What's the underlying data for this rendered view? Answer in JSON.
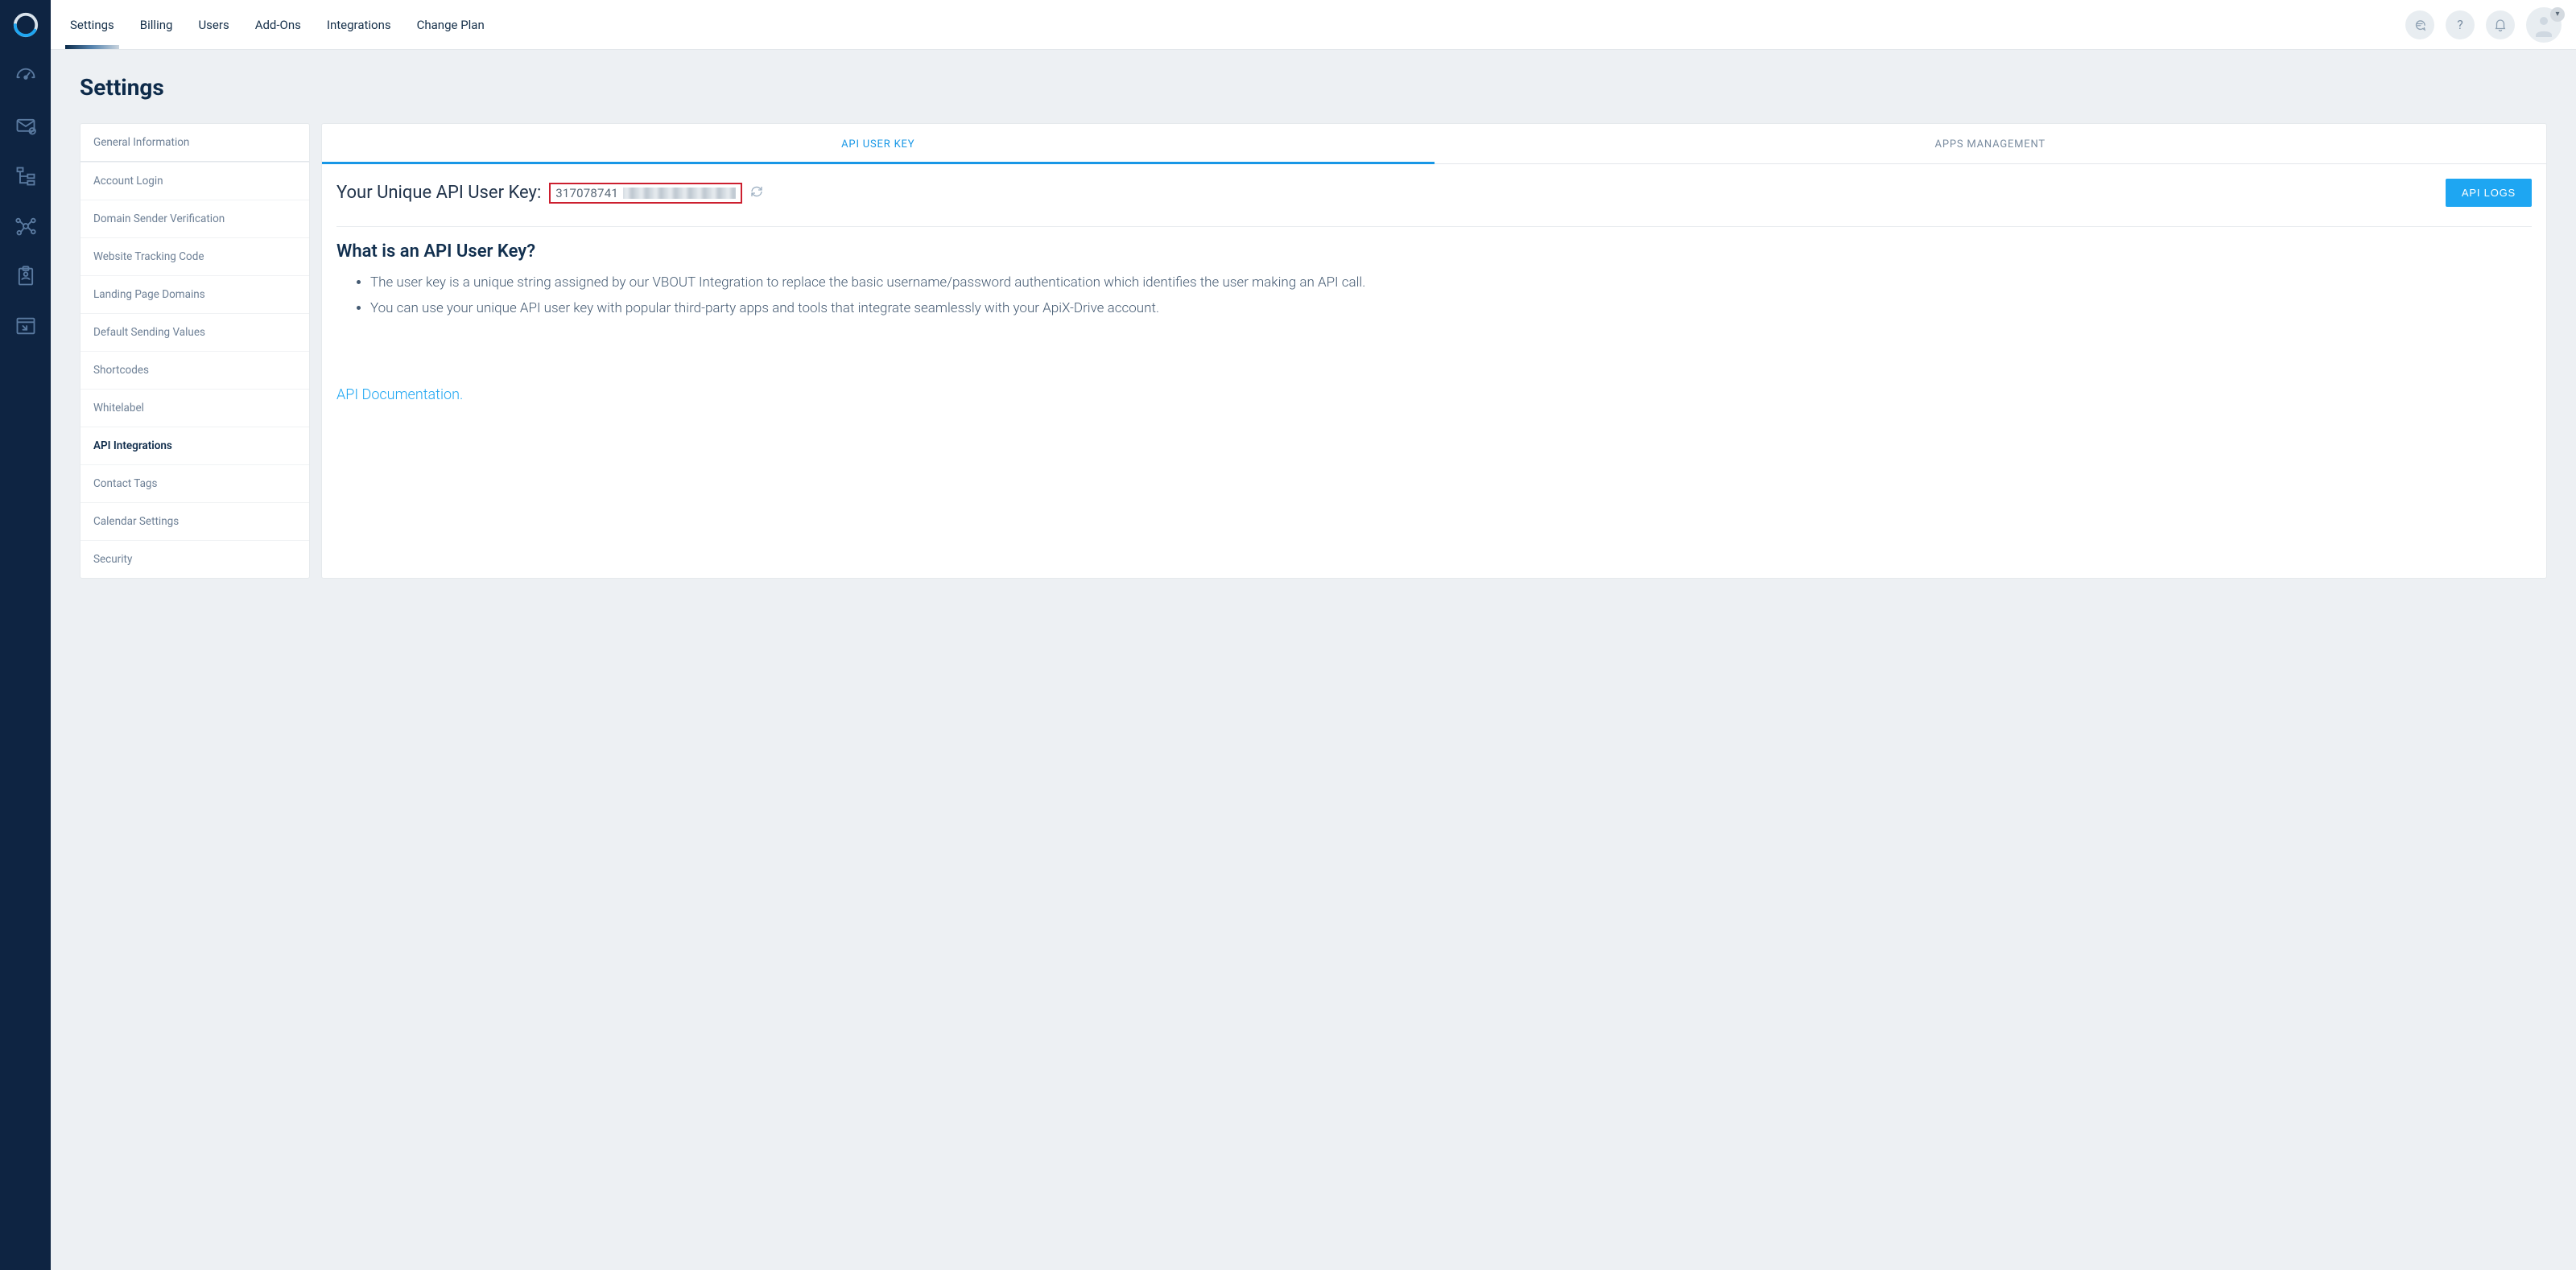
{
  "topnav": {
    "items": [
      {
        "label": "Settings",
        "active": true
      },
      {
        "label": "Billing"
      },
      {
        "label": "Users"
      },
      {
        "label": "Add-Ons"
      },
      {
        "label": "Integrations"
      },
      {
        "label": "Change Plan"
      }
    ]
  },
  "page": {
    "title": "Settings"
  },
  "sidebar": {
    "items": [
      {
        "label": "General Information"
      },
      {
        "label": "Account Login"
      },
      {
        "label": "Domain Sender Verification"
      },
      {
        "label": "Website Tracking Code"
      },
      {
        "label": "Landing Page Domains"
      },
      {
        "label": "Default Sending Values"
      },
      {
        "label": "Shortcodes"
      },
      {
        "label": "Whitelabel"
      },
      {
        "label": "API Integrations",
        "active": true
      },
      {
        "label": "Contact Tags"
      },
      {
        "label": "Calendar Settings"
      },
      {
        "label": "Security"
      }
    ]
  },
  "tabs": {
    "items": [
      {
        "label": "API USER KEY",
        "active": true
      },
      {
        "label": "APPS MANAGEMENT"
      }
    ]
  },
  "api": {
    "label": "Your Unique API User Key:",
    "key_visible": "317078741",
    "api_logs_label": "API LOGS",
    "info_title": "What is an API User Key?",
    "bullets": [
      "The user key is a unique string assigned by our VBOUT Integration to replace the basic username/password authentication which identifies the user making an API call.",
      "You can use your unique API user key with popular third-party apps and tools that integrate seamlessly with your ApiX-Drive account."
    ],
    "doc_link_label": "API Documentation."
  },
  "top_actions": {
    "help_label": "?"
  }
}
